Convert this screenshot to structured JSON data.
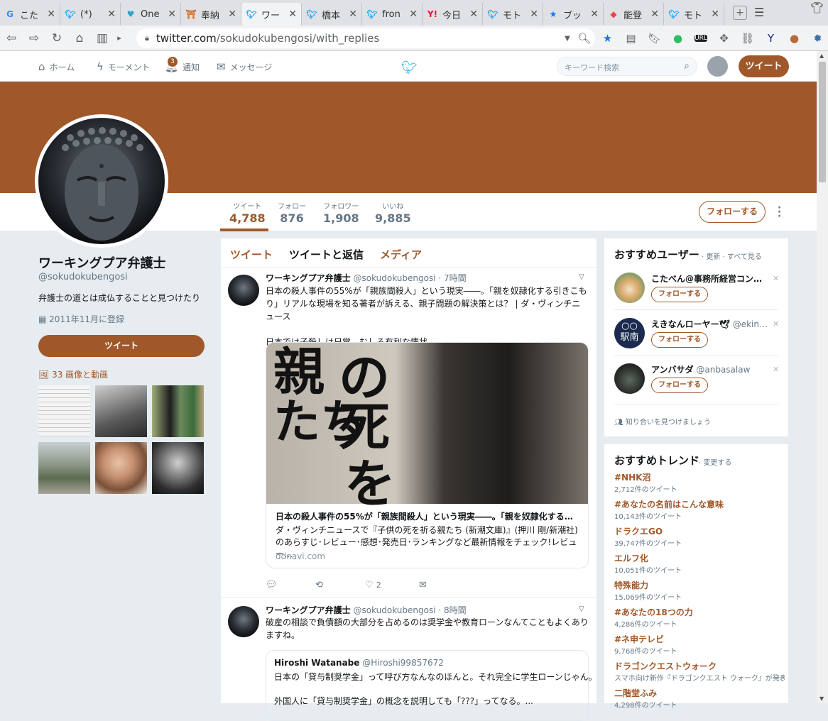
{
  "browser": {
    "tabs": [
      {
        "icon": "google-icon",
        "title": "こた",
        "active": false
      },
      {
        "icon": "twitter-icon",
        "title": "(*) ",
        "active": false
      },
      {
        "icon": "heart-icon",
        "title": "One",
        "active": false
      },
      {
        "icon": "shrine-icon",
        "title": "奉納",
        "active": false
      },
      {
        "icon": "twitter-icon",
        "title": "ワー",
        "active": true
      },
      {
        "icon": "twitter-icon",
        "title": "橋本",
        "active": false
      },
      {
        "icon": "twitter-icon",
        "title": "fron",
        "active": false
      },
      {
        "icon": "yahoo-icon",
        "title": "今日",
        "active": false
      },
      {
        "icon": "twitter-icon",
        "title": "モト",
        "active": false
      },
      {
        "icon": "star-icon",
        "title": "ブッ",
        "active": false
      },
      {
        "icon": "cube-icon",
        "title": "能登",
        "active": false
      },
      {
        "icon": "twitter-icon",
        "title": "モト",
        "active": false
      }
    ],
    "url_host": "twitter.com",
    "url_path": "/sokudokubengosi/with_replies"
  },
  "nav": {
    "home": "ホーム",
    "moments": "モーメント",
    "notifications": "通知",
    "notifications_count": "3",
    "messages": "メッセージ",
    "search_placeholder": "キーワード検索",
    "tweet_button": "ツイート"
  },
  "profile": {
    "stats": [
      {
        "label": "ツイート",
        "value": "4,788"
      },
      {
        "label": "フォロー",
        "value": "876"
      },
      {
        "label": "フォロワー",
        "value": "1,908"
      },
      {
        "label": "いいね",
        "value": "9,885"
      }
    ],
    "follow_button": "フォローする",
    "name": "ワーキングプア弁護士",
    "handle": "@sokudokubengosi",
    "bio": "弁護士の道とは成仏することと見つけたり",
    "joined": "2011年11月に登録",
    "tweet_button": "ツイート",
    "media_label": "33 画像と動画",
    "accent_color": "#a0582a"
  },
  "timeline": {
    "tabs": [
      "ツイート",
      "ツイートと返信",
      "メディア"
    ],
    "tweets": [
      {
        "name": "ワーキングプア弁護士",
        "handle": "@sokudokubengosi",
        "time": "7時間",
        "text": "日本の殺人事件の55%が「親族間殺人」という現実――。「親を奴隷化する引きこもり」リアルな現場を知る著者が訴える、親子問題の解決策とは？ | ダ・ヴィンチニュース\n\n日本では子殺しは日常。むしろ有利な情状。",
        "card": {
          "image_text_1": "の",
          "image_text_2": "親",
          "image_text_3": "たち",
          "image_text_4": "死",
          "image_text_5": "を",
          "title": "日本の殺人事件の55%が「親族間殺人」という現実――。「親を奴隷化する引き…",
          "description": "ダ・ヴィンチニュースで『子供の死を祈る親たち (新潮文庫)』(押川 剛/新潮社)のあらすじ･レビュー･感想･発売日･ランキングなど最新情報をチェック!レビュー…",
          "domain": "ddnavi.com"
        },
        "likes": "2"
      },
      {
        "name": "ワーキングプア弁護士",
        "handle": "@sokudokubengosi",
        "time": "8時間",
        "text": "破産の相談で負債額の大部分を占めるのは奨学金や教育ローンなんてこともよくありますね。",
        "quote": {
          "name": "Hiroshi Watanabe",
          "handle": "@Hiroshi99857672",
          "line1": "日本の「貸与制奨学金」って呼び方なんなのほんと。それ完全に学生ローンじゃん。",
          "line2": "外国人に「貸与制奨学金」の概念を説明しても「???」ってなる。..."
        }
      }
    ]
  },
  "who_to_follow": {
    "title": "おすすめユーザー",
    "links": "· 更新 · すべて見る",
    "follow_label": "フォローする",
    "users": [
      {
        "name": "こたべん@事務所経営コン…",
        "handle": ""
      },
      {
        "name": "えきなんローヤー🕊",
        "handle": "@ekin…"
      },
      {
        "name": "アンバサダ",
        "handle": "@anbasalaw"
      }
    ],
    "find_people": "知り合いを見つけましょう"
  },
  "trends": {
    "title": "おすすめトレンド",
    "change": "· 変更する",
    "items": [
      {
        "name": "#NHK沼",
        "count": "2,712件のツイート"
      },
      {
        "name": "#あなたの名前はこんな意味",
        "count": "10,143件のツイート"
      },
      {
        "name": "ドラクエGO",
        "count": "39,747件のツイート"
      },
      {
        "name": "エルフ化",
        "count": "10,051件のツイート"
      },
      {
        "name": "特殊能力",
        "count": "15,069件のツイート"
      },
      {
        "name": "#あなたの18つの力",
        "count": "4,286件のツイート"
      },
      {
        "name": "#ネ申テレビ",
        "count": "9,768件のツイート"
      },
      {
        "name": "ドラゴンクエストウォーク",
        "count": "スマホ向け新作『ドラゴンクエスト ウォーク』が発表"
      },
      {
        "name": "二階堂ふみ",
        "count": "4,298件のツイート"
      }
    ]
  }
}
